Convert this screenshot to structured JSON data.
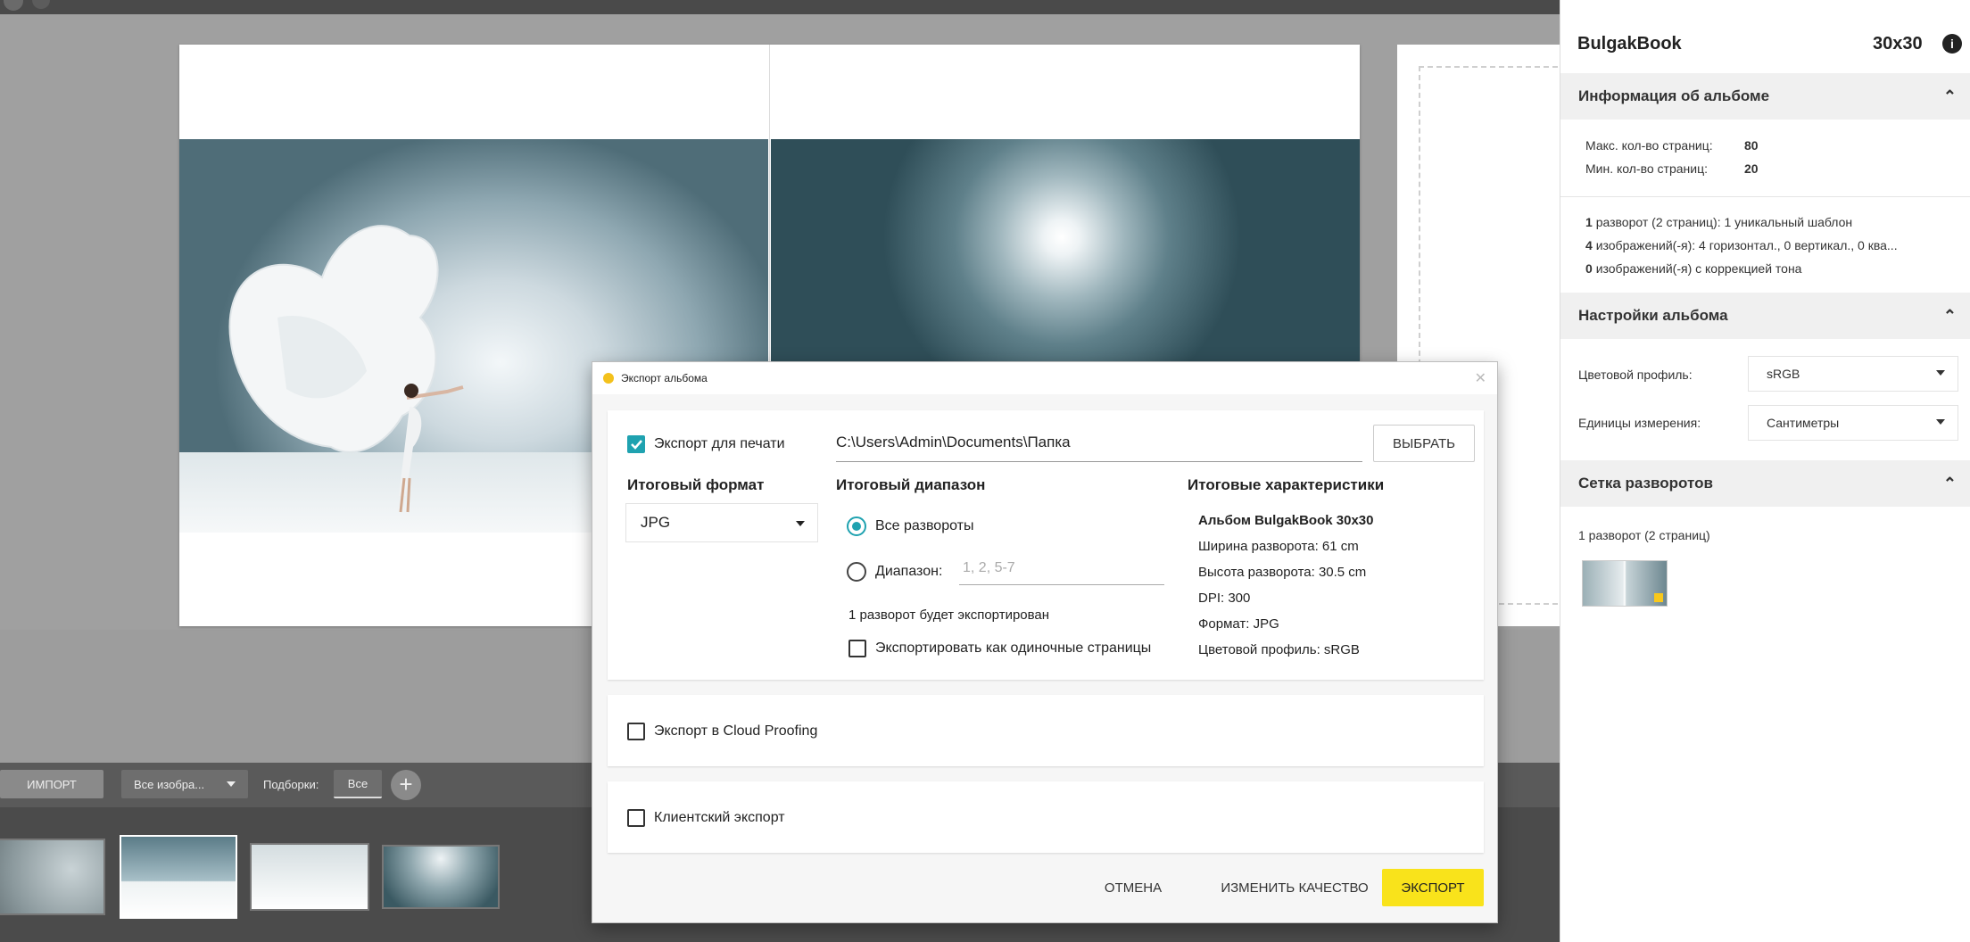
{
  "colors": {
    "accent": "#1fa2b0",
    "export_button": "#f9e31b",
    "dark_bar": "#4b4b4b"
  },
  "filmstrip": {
    "import_label": "ИМПОРТ",
    "images_filter": "Все изобра...",
    "collections_label": "Подборки:",
    "collection_all": "Все",
    "add_icon": "plus-icon"
  },
  "panel": {
    "title": "BulgakBook",
    "size": "30x30",
    "info_icon": "info-icon",
    "album_info": {
      "heading": "Информация об альбоме",
      "max_pages_label": "Макс. кол-во страниц:",
      "max_pages": "80",
      "min_pages_label": "Мин. кол-во страниц:",
      "min_pages": "20",
      "spreads_count": "1",
      "spreads_text": "разворот (2 страниц): 1 уникальный шаблон",
      "images_count": "4",
      "images_text": "изображений(-я): 4 горизонтал., 0 вертикал., 0 ква...",
      "tone_count": "0",
      "tone_text": "изображений(-я) с коррекцией тона"
    },
    "album_settings": {
      "heading": "Настройки альбома",
      "color_profile_label": "Цветовой профиль:",
      "color_profile": "sRGB",
      "units_label": "Единицы измерения:",
      "units": "Сантиметры"
    },
    "spread_grid": {
      "heading": "Сетка разворотов",
      "caption": "1 разворот (2 страниц)"
    }
  },
  "dialog": {
    "title": "Экспорт альбома",
    "print": {
      "checkbox_label": "Экспорт для печати",
      "checked": true,
      "path": "C:\\Users\\Admin\\Documents\\Папка",
      "choose_button": "ВЫБРАТЬ",
      "format_heading": "Итоговый формат",
      "format_value": "JPG",
      "range_heading": "Итоговый диапазон",
      "all_spreads_label": "Все развороты",
      "range_label": "Диапазон:",
      "range_placeholder": "1, 2, 5-7",
      "export_note": "1 разворот будет экспортирован",
      "single_pages_label": "Экспортировать как одиночные страницы",
      "summary_heading": "Итоговые характеристики",
      "summary": [
        "Альбом BulgakBook 30x30",
        "Ширина разворота: 61 cm",
        "Высота разворота: 30.5 cm",
        "DPI: 300",
        "Формат: JPG",
        "Цветовой профиль: sRGB"
      ]
    },
    "cloud_label": "Экспорт в Cloud Proofing",
    "client_label": "Клиентский экспорт",
    "cancel_button": "ОТМЕНА",
    "quality_button": "ИЗМЕНИТЬ КАЧЕСТВО",
    "export_button": "ЭКСПОРТ"
  }
}
